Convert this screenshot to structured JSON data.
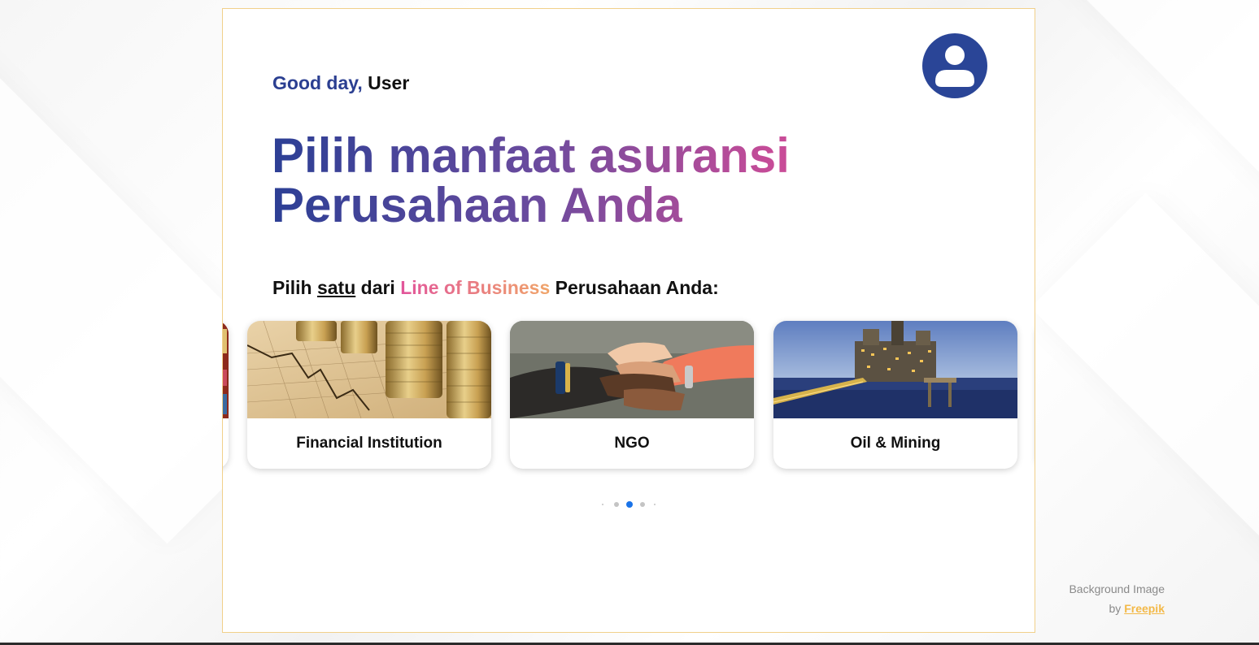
{
  "greeting": {
    "salutation": "Good day,",
    "user_name": "User"
  },
  "headline": {
    "line1": "Pilih manfaat asuransi",
    "line2": "Perusahaan Anda"
  },
  "subtitle": {
    "part1": "Pilih",
    "underlined": "satu",
    "part2": "dari",
    "highlight": "Line of Business",
    "part3": "Perusahaan Anda:"
  },
  "carousel": {
    "cards": [
      {
        "label": "Financial Institution",
        "icon": "coins-chart-image"
      },
      {
        "label": "NGO",
        "icon": "stacked-hands-image"
      },
      {
        "label": "Oil & Mining",
        "icon": "offshore-rig-image"
      }
    ],
    "active_dot": 3,
    "dot_count": 5
  },
  "credit": {
    "line1": "Background Image",
    "by": "by",
    "link": "Freepik"
  },
  "colors": {
    "brand_blue": "#2a4597",
    "accent_pink": "#d84f96",
    "accent_orange": "#f0a569",
    "link_gold": "#f3b948",
    "active_dot": "#1a73e8"
  }
}
